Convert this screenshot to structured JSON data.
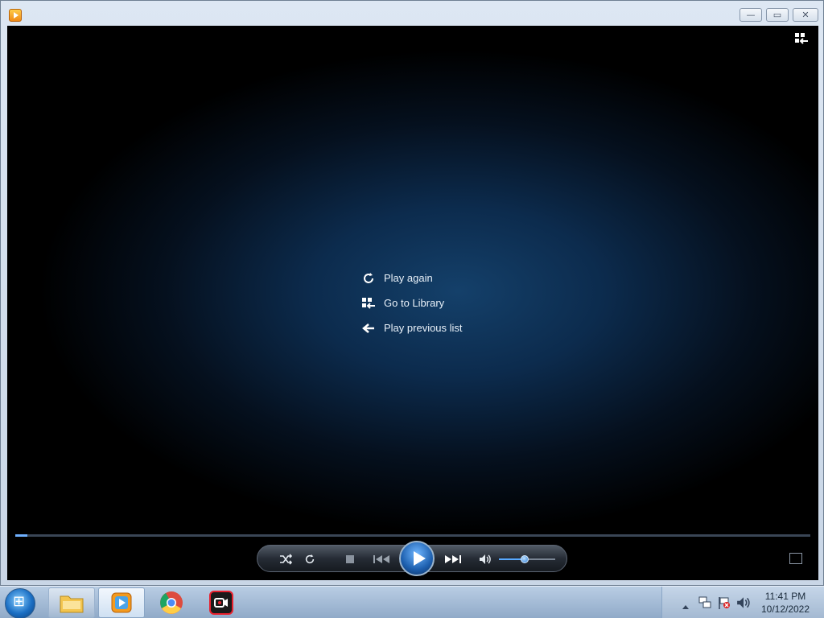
{
  "window": {
    "controls": {
      "minimize": "—",
      "maximize": "▭",
      "close": "✕"
    }
  },
  "player": {
    "menu": [
      {
        "icon": "refresh-icon",
        "label": "Play again"
      },
      {
        "icon": "library-icon",
        "label": "Go to Library"
      },
      {
        "icon": "back-arrow-icon",
        "label": "Play previous list"
      }
    ],
    "seek_progress_fraction": 0.015,
    "volume_fraction": 0.45,
    "colors": {
      "accent": "#2f7fd6",
      "background": "#0c2b4d"
    }
  },
  "taskbar": {
    "items": [
      {
        "icon": "file-explorer-icon"
      },
      {
        "icon": "windows-media-player-icon",
        "active": true
      },
      {
        "icon": "chrome-icon"
      },
      {
        "icon": "screen-recorder-icon"
      }
    ],
    "clock": {
      "time": "11:41 PM",
      "date": "10/12/2022"
    }
  }
}
